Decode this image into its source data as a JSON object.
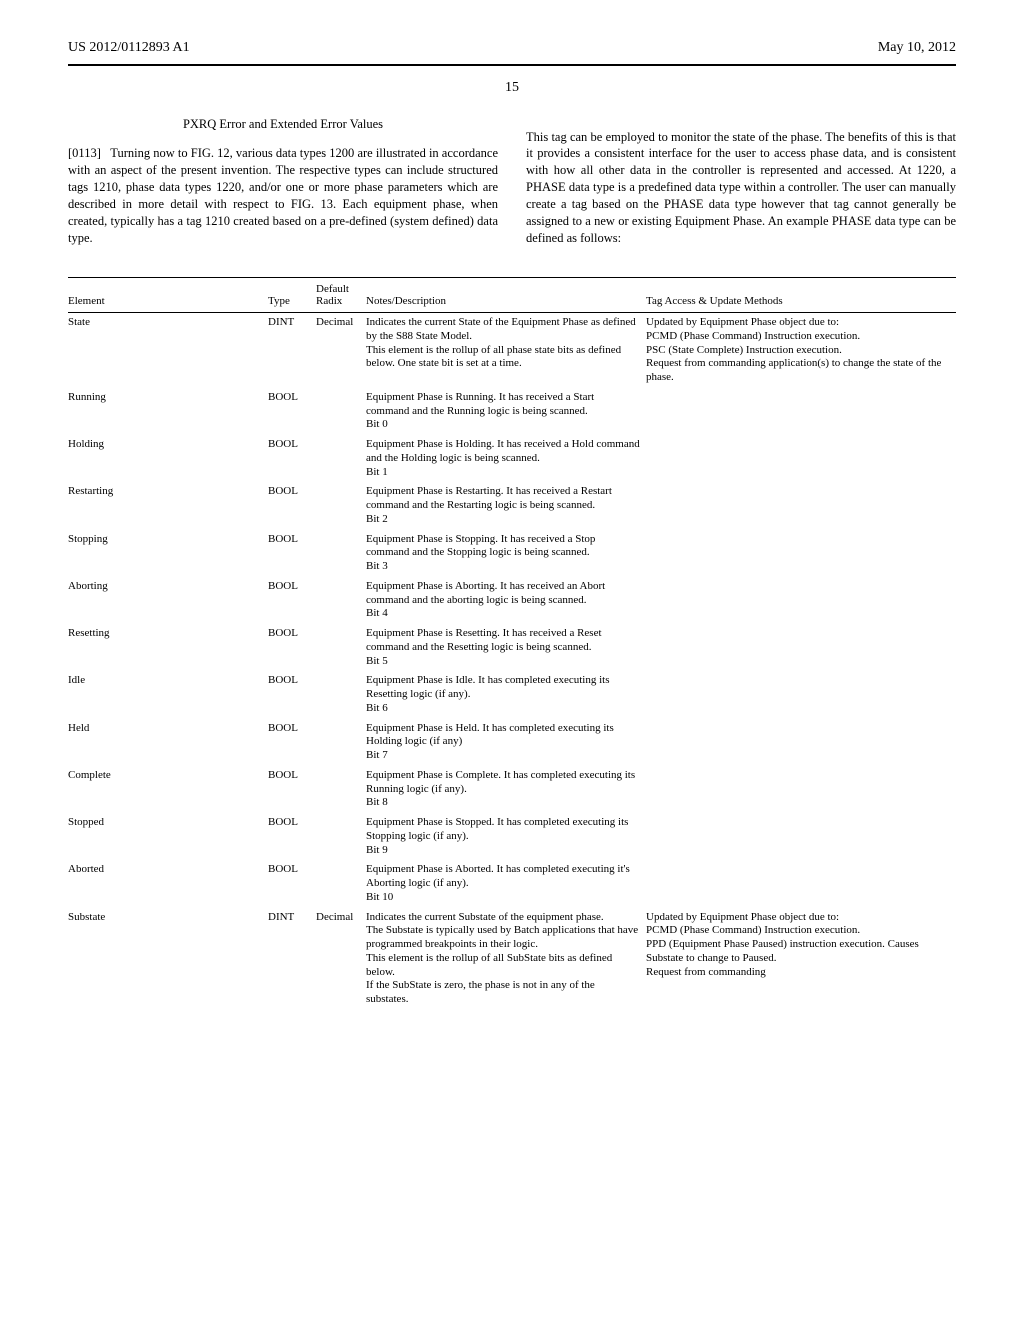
{
  "header": {
    "left": "US 2012/0112893 A1",
    "right": "May 10, 2012",
    "page_number": "15"
  },
  "left_column": {
    "title": "PXRQ Error and Extended Error Values",
    "para_label": "[0113]",
    "para_text": "Turning now to FIG. 12, various data types 1200 are illustrated in accordance with an aspect of the present invention. The respective types can include structured tags 1210, phase data types 1220, and/or one or more phase parameters which are described in more detail with respect to FIG. 13. Each equipment phase, when created, typically has a tag 1210 created based on a pre-defined (system defined) data type."
  },
  "right_column": {
    "para_text": "This tag can be employed to monitor the state of the phase. The benefits of this is that it provides a consistent interface for the user to access phase data, and is consistent with how all other data in the controller is represented and accessed. At 1220, a PHASE data type is a predefined data type within a controller. The user can manually create a tag based on the PHASE data type however that tag cannot generally be assigned to a new or existing Equipment Phase. An example PHASE data type can be defined as follows:"
  },
  "table": {
    "headers": {
      "element": "Element",
      "type": "Type",
      "radix": "Default Radix",
      "notes": "Notes/Description",
      "access": "Tag Access & Update Methods"
    },
    "rows": [
      {
        "element": "State",
        "type": "DINT",
        "radix": "Decimal",
        "notes": "Indicates the current State of the Equipment Phase as defined by the S88 State Model.\nThis element is the rollup of all phase state bits as defined below. One state bit is set at a time.",
        "access": "Updated by Equipment Phase object due to:\nPCMD (Phase Command) Instruction execution.\nPSC (State Complete) Instruction execution.\nRequest from commanding application(s) to change the state of the phase."
      },
      {
        "element": "Running",
        "type": "BOOL",
        "radix": "",
        "notes": "Equipment Phase is Running. It has received a Start command and the Running logic is being scanned.\nBit 0",
        "access": ""
      },
      {
        "element": "Holding",
        "type": "BOOL",
        "radix": "",
        "notes": "Equipment Phase is Holding. It has received a Hold command and the Holding logic is being scanned.\nBit 1",
        "access": ""
      },
      {
        "element": "Restarting",
        "type": "BOOL",
        "radix": "",
        "notes": "Equipment Phase is Restarting. It has received a Restart command and the Restarting logic is being scanned.\nBit 2",
        "access": ""
      },
      {
        "element": "Stopping",
        "type": "BOOL",
        "radix": "",
        "notes": "Equipment Phase is Stopping. It has received a Stop command and the Stopping logic is being scanned.\nBit 3",
        "access": ""
      },
      {
        "element": "Aborting",
        "type": "BOOL",
        "radix": "",
        "notes": "Equipment Phase is Aborting. It has received an Abort command and the aborting logic is being scanned.\nBit 4",
        "access": ""
      },
      {
        "element": "Resetting",
        "type": "BOOL",
        "radix": "",
        "notes": "Equipment Phase is Resetting. It has received a Reset command and the Resetting logic is being scanned.\nBit 5",
        "access": ""
      },
      {
        "element": "Idle",
        "type": "BOOL",
        "radix": "",
        "notes": "Equipment Phase is Idle. It has completed executing its Resetting logic (if any).\nBit 6",
        "access": ""
      },
      {
        "element": "Held",
        "type": "BOOL",
        "radix": "",
        "notes": "Equipment Phase is Held. It has completed executing its Holding logic (if any)\nBit 7",
        "access": ""
      },
      {
        "element": "Complete",
        "type": "BOOL",
        "radix": "",
        "notes": "Equipment Phase is Complete. It has completed executing its Running logic (if any).\nBit 8",
        "access": ""
      },
      {
        "element": "Stopped",
        "type": "BOOL",
        "radix": "",
        "notes": "Equipment Phase is Stopped. It has completed executing its Stopping logic (if any).\nBit 9",
        "access": ""
      },
      {
        "element": "Aborted",
        "type": "BOOL",
        "radix": "",
        "notes": "Equipment Phase is Aborted. It has completed executing it's Aborting logic (if any).\nBit 10",
        "access": ""
      },
      {
        "element": "Substate",
        "type": "DINT",
        "radix": "Decimal",
        "notes": "Indicates the current Substate of the equipment phase.\nThe Substate is typically used by Batch applications that have programmed breakpoints in their logic.\nThis element is the rollup of all SubState bits as defined below.\nIf the SubState is zero, the phase is not in any of the substates.",
        "access": "Updated by Equipment Phase object due to:\nPCMD (Phase Command) Instruction execution.\nPPD (Equipment Phase Paused) instruction execution. Causes Substate to change to Paused.\nRequest from commanding"
      }
    ]
  }
}
